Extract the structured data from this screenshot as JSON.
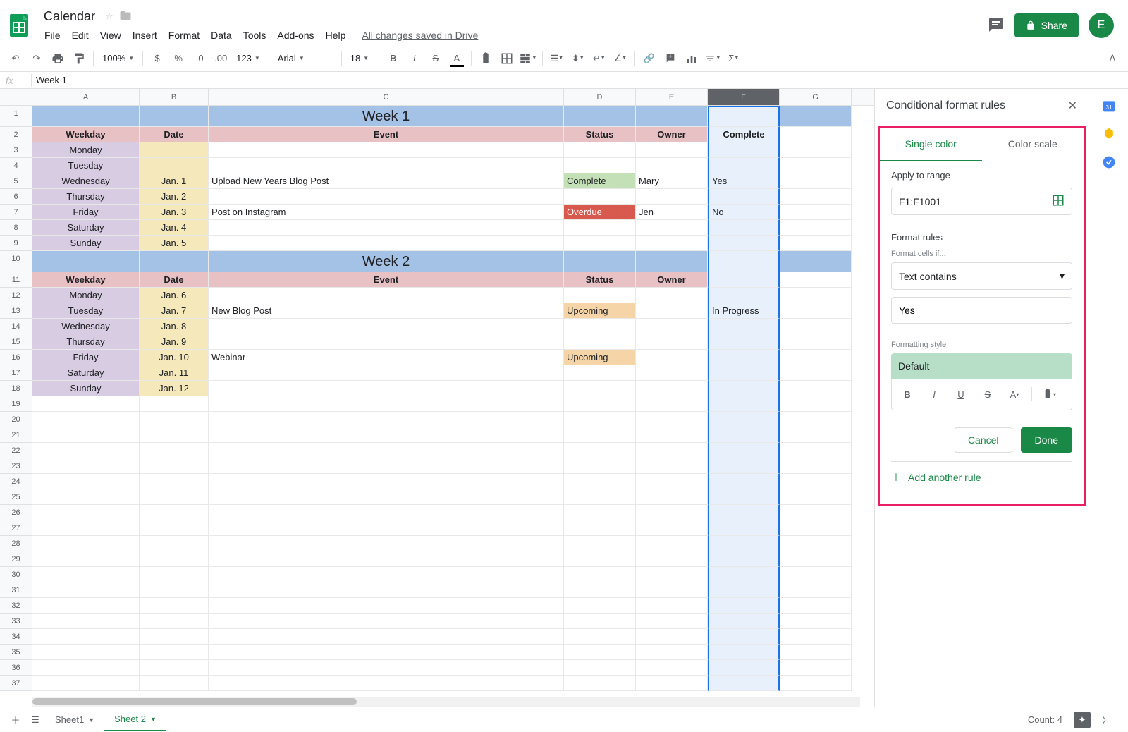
{
  "doc_title": "Calendar",
  "menus": [
    "File",
    "Edit",
    "View",
    "Insert",
    "Format",
    "Data",
    "Tools",
    "Add-ons",
    "Help"
  ],
  "save_status": "All changes saved in Drive",
  "share": "Share",
  "avatar": "E",
  "zoom": "100%",
  "font": "Arial",
  "font_size": "18",
  "formula_value": "Week 1",
  "columns": [
    "A",
    "B",
    "C",
    "D",
    "E",
    "F",
    "G"
  ],
  "headers_week1": {
    "weekday": "Weekday",
    "date": "Date",
    "event": "Event",
    "status": "Status",
    "owner": "Owner",
    "complete": "Complete"
  },
  "headers_week2": {
    "weekday": "Weekday",
    "date": "Date",
    "event": "Event",
    "status": "Status",
    "owner": "Owner"
  },
  "week1_title": "Week 1",
  "week2_title": "Week 2",
  "week1_rows": [
    {
      "weekday": "Monday",
      "date": "",
      "event": "",
      "status": "",
      "owner": "",
      "complete": ""
    },
    {
      "weekday": "Tuesday",
      "date": "",
      "event": "",
      "status": "",
      "owner": "",
      "complete": ""
    },
    {
      "weekday": "Wednesday",
      "date": "Jan. 1",
      "event": "Upload New Years Blog Post",
      "status": "Complete",
      "status_cls": "status-complete",
      "owner": "Mary",
      "complete": "Yes",
      "complete_cls": "complete-yes"
    },
    {
      "weekday": "Thursday",
      "date": "Jan. 2",
      "event": "",
      "status": "",
      "owner": "",
      "complete": ""
    },
    {
      "weekday": "Friday",
      "date": "Jan. 3",
      "event": "Post on Instagram",
      "status": "Overdue",
      "status_cls": "status-overdue",
      "owner": "Jen",
      "complete": "No"
    },
    {
      "weekday": "Saturday",
      "date": "Jan. 4",
      "event": "",
      "status": "",
      "owner": "",
      "complete": ""
    },
    {
      "weekday": "Sunday",
      "date": "Jan. 5",
      "event": "",
      "status": "",
      "owner": "",
      "complete": ""
    }
  ],
  "week2_rows": [
    {
      "weekday": "Monday",
      "date": "Jan. 6",
      "event": "",
      "status": "",
      "owner": "",
      "complete": ""
    },
    {
      "weekday": "Tuesday",
      "date": "Jan. 7",
      "event": "New Blog Post",
      "status": "Upcoming",
      "status_cls": "status-upcoming",
      "owner": "",
      "complete": "In Progress"
    },
    {
      "weekday": "Wednesday",
      "date": "Jan. 8",
      "event": "",
      "status": "",
      "owner": "",
      "complete": ""
    },
    {
      "weekday": "Thursday",
      "date": "Jan. 9",
      "event": "",
      "status": "",
      "owner": "",
      "complete": ""
    },
    {
      "weekday": "Friday",
      "date": "Jan. 10",
      "event": "Webinar",
      "status": "Upcoming",
      "status_cls": "status-upcoming",
      "owner": "",
      "complete": ""
    },
    {
      "weekday": "Saturday",
      "date": "Jan. 11",
      "event": "",
      "status": "",
      "owner": "",
      "complete": ""
    },
    {
      "weekday": "Sunday",
      "date": "Jan. 12",
      "event": "",
      "status": "",
      "owner": "",
      "complete": ""
    }
  ],
  "sidebar": {
    "title": "Conditional format rules",
    "tab_single": "Single color",
    "tab_scale": "Color scale",
    "apply_label": "Apply to range",
    "range": "F1:F1001",
    "format_rules": "Format rules",
    "cells_if": "Format cells if...",
    "condition": "Text contains",
    "value": "Yes",
    "style_label": "Formatting style",
    "default": "Default",
    "cancel": "Cancel",
    "done": "Done",
    "add_rule": "Add another rule"
  },
  "sheets": {
    "s1": "Sheet1",
    "s2": "Sheet 2"
  },
  "count": "Count: 4"
}
